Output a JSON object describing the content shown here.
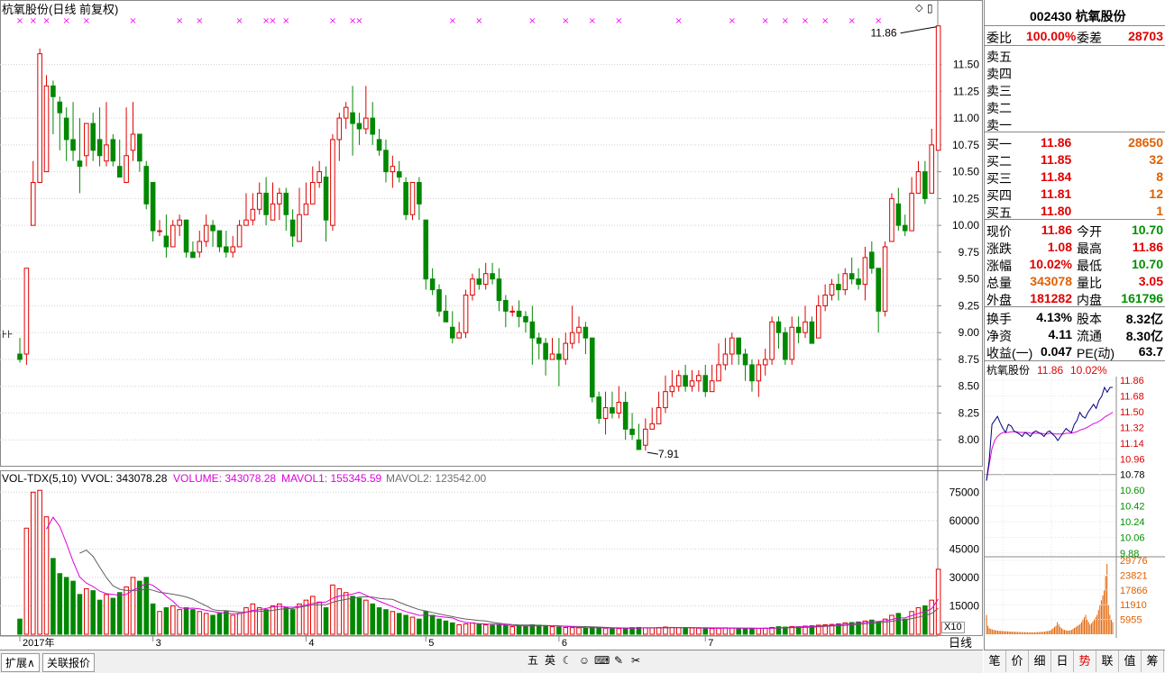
{
  "title": "杭氧股份(日线 前复权)",
  "price_axis": [
    "11.50",
    "11.25",
    "11.00",
    "10.75",
    "10.50",
    "10.25",
    "10.00",
    "9.75",
    "9.50",
    "9.25",
    "9.00",
    "8.75",
    "8.50",
    "8.25",
    "8.00"
  ],
  "vol_axis": [
    "75000",
    "60000",
    "45000",
    "30000",
    "15000"
  ],
  "x10_label": "X10",
  "annotations": {
    "high": "11.86",
    "low": "7.91",
    "left_marker": "⊦⊦"
  },
  "vol_header": {
    "name": "VOL-TDX(5,10)",
    "vvol": "VVOL: 343078.28",
    "volume": "VOLUME: 343078.28",
    "mavol1": "MAVOL1: 155345.59",
    "mavol2": "MAVOL2: 123542.00"
  },
  "date_labels": [
    {
      "label": "2017年",
      "i": 0
    },
    {
      "label": "3",
      "i": 20
    },
    {
      "label": "4",
      "i": 43
    },
    {
      "label": "5",
      "i": 61
    },
    {
      "label": "6",
      "i": 81
    },
    {
      "label": "7",
      "i": 103
    }
  ],
  "period_label": "日线",
  "bottom_tabs": [
    "扩展∧",
    "关联报价"
  ],
  "tool_icons": [
    "五",
    "英",
    "☾",
    "☺",
    "⌨",
    "✎",
    "✂"
  ],
  "colors": {
    "up": "#e00000",
    "down": "#008800",
    "ma1": "#e000e0",
    "ma2": "#606060",
    "marker": "#ff00ff",
    "label": "#ff00ff"
  },
  "side": {
    "header": "002430 杭氧股份",
    "weibi": {
      "label1": "委比",
      "v1": "100.00%",
      "label2": "委差",
      "v2": "28703"
    },
    "sells": [
      {
        "label": "卖五",
        "price": "",
        "vol": ""
      },
      {
        "label": "卖四",
        "price": "",
        "vol": ""
      },
      {
        "label": "卖三",
        "price": "",
        "vol": ""
      },
      {
        "label": "卖二",
        "price": "",
        "vol": ""
      },
      {
        "label": "卖一",
        "price": "",
        "vol": ""
      }
    ],
    "buys": [
      {
        "label": "买一",
        "price": "11.86",
        "vol": "28650"
      },
      {
        "label": "买二",
        "price": "11.85",
        "vol": "32"
      },
      {
        "label": "买三",
        "price": "11.84",
        "vol": "8"
      },
      {
        "label": "买四",
        "price": "11.81",
        "vol": "12"
      },
      {
        "label": "买五",
        "price": "11.80",
        "vol": "1"
      }
    ],
    "quotes": [
      {
        "l1": "现价",
        "v1": "11.86",
        "c1": "red",
        "l2": "今开",
        "v2": "10.70",
        "c2": "grn"
      },
      {
        "l1": "涨跌",
        "v1": "1.08",
        "c1": "red",
        "l2": "最高",
        "v2": "11.86",
        "c2": "red"
      },
      {
        "l1": "涨幅",
        "v1": "10.02%",
        "c1": "red",
        "l2": "最低",
        "v2": "10.70",
        "c2": "grn"
      },
      {
        "l1": "总量",
        "v1": "343078",
        "c1": "org",
        "l2": "量比",
        "v2": "3.05",
        "c2": "red"
      },
      {
        "l1": "外盘",
        "v1": "181282",
        "c1": "red",
        "l2": "内盘",
        "v2": "161796",
        "c2": "grn"
      }
    ],
    "fin": [
      {
        "l1": "换手",
        "v1": "4.13%",
        "l2": "股本",
        "v2": "8.32亿"
      },
      {
        "l1": "净资",
        "v1": "4.11",
        "l2": "流通",
        "v2": "8.30亿"
      },
      {
        "l1": "收益(一)",
        "v1": "0.047",
        "l2": "PE(动)",
        "v2": "63.7"
      }
    ],
    "mini_title": "杭氧股份",
    "mini_price": "11.86",
    "mini_pct": "10.02%",
    "mini_price_axis": [
      {
        "v": "11.86",
        "c": "red"
      },
      {
        "v": "11.68",
        "c": "red"
      },
      {
        "v": "11.50",
        "c": "red"
      },
      {
        "v": "11.32",
        "c": "red"
      },
      {
        "v": "11.14",
        "c": "red"
      },
      {
        "v": "10.96",
        "c": "red"
      },
      {
        "v": "10.78",
        "c": "blk"
      },
      {
        "v": "10.60",
        "c": "grn"
      },
      {
        "v": "10.42",
        "c": "grn"
      },
      {
        "v": "10.24",
        "c": "grn"
      },
      {
        "v": "10.06",
        "c": "grn"
      },
      {
        "v": "9.88",
        "c": "grn"
      }
    ],
    "mini_vol_axis": [
      "29776",
      "23821",
      "17866",
      "11910",
      "5955"
    ],
    "tabs": [
      "笔",
      "价",
      "细",
      "日",
      "势",
      "联",
      "值",
      "筹"
    ]
  },
  "chart_data": {
    "type": "candlestick",
    "title": "杭氧股份(日线 前复权)",
    "ylim": [
      7.75,
      11.95
    ],
    "vol_ylim": [
      0,
      78000
    ],
    "price_ticks": [
      8.0,
      8.25,
      8.5,
      8.75,
      9.0,
      9.25,
      9.5,
      9.75,
      10.0,
      10.25,
      10.5,
      10.75,
      11.0,
      11.25,
      11.5
    ],
    "vol_ticks": [
      15000,
      30000,
      45000,
      60000,
      75000
    ],
    "candles": [
      [
        8.8,
        8.75,
        8.95,
        8.72,
        8000
      ],
      [
        8.8,
        9.6,
        9.6,
        8.7,
        56000
      ],
      [
        10.0,
        10.4,
        10.6,
        10.0,
        75000
      ],
      [
        10.4,
        11.6,
        11.65,
        10.4,
        76000
      ],
      [
        10.5,
        11.3,
        11.4,
        10.5,
        62000
      ],
      [
        11.3,
        11.2,
        11.35,
        10.85,
        40000
      ],
      [
        11.15,
        11.05,
        11.2,
        10.7,
        32000
      ],
      [
        11.0,
        10.8,
        11.1,
        10.6,
        30000
      ],
      [
        10.8,
        10.7,
        11.15,
        10.6,
        28000
      ],
      [
        10.6,
        10.55,
        11.0,
        10.3,
        21000
      ],
      [
        10.65,
        10.95,
        10.95,
        10.55,
        24000
      ],
      [
        10.95,
        10.7,
        11.05,
        10.6,
        23000
      ],
      [
        10.8,
        10.65,
        11.1,
        10.55,
        18000
      ],
      [
        10.6,
        10.75,
        11.15,
        10.55,
        21000
      ],
      [
        10.8,
        10.6,
        10.85,
        10.55,
        19000
      ],
      [
        10.55,
        10.45,
        10.8,
        10.45,
        22000
      ],
      [
        10.4,
        10.65,
        11.1,
        10.4,
        25000
      ],
      [
        10.7,
        10.85,
        11.15,
        10.6,
        30000
      ],
      [
        10.85,
        10.6,
        10.85,
        10.5,
        28000
      ],
      [
        10.55,
        10.2,
        10.6,
        10.15,
        30000
      ],
      [
        10.4,
        9.95,
        10.4,
        9.85,
        16000
      ],
      [
        9.95,
        9.95,
        10.05,
        9.9,
        12000
      ],
      [
        9.9,
        9.8,
        10.1,
        9.7,
        14000
      ],
      [
        9.8,
        10.0,
        10.05,
        9.8,
        15000
      ],
      [
        10.0,
        10.05,
        10.1,
        9.9,
        13000
      ],
      [
        10.05,
        9.75,
        10.05,
        9.7,
        14000
      ],
      [
        9.75,
        9.7,
        9.85,
        9.7,
        13000
      ],
      [
        9.75,
        9.85,
        9.95,
        9.7,
        12000
      ],
      [
        9.85,
        10.0,
        10.1,
        9.8,
        11000
      ],
      [
        10.0,
        9.95,
        10.05,
        9.8,
        10000
      ],
      [
        9.95,
        9.8,
        9.95,
        9.75,
        11000
      ],
      [
        9.8,
        9.75,
        9.95,
        9.7,
        12000
      ],
      [
        9.75,
        9.8,
        9.9,
        9.7,
        10000
      ],
      [
        9.8,
        10.0,
        10.05,
        9.8,
        11000
      ],
      [
        10.0,
        10.05,
        10.3,
        10.0,
        14000
      ],
      [
        10.05,
        10.15,
        10.3,
        10.0,
        16000
      ],
      [
        10.15,
        10.3,
        10.4,
        10.1,
        14000
      ],
      [
        10.3,
        10.1,
        10.45,
        10.0,
        13000
      ],
      [
        10.05,
        10.2,
        10.4,
        10.05,
        15000
      ],
      [
        10.2,
        10.3,
        10.35,
        10.05,
        16000
      ],
      [
        10.3,
        10.1,
        10.35,
        9.95,
        14000
      ],
      [
        10.05,
        9.9,
        10.15,
        9.8,
        13000
      ],
      [
        9.85,
        10.1,
        10.35,
        9.85,
        16000
      ],
      [
        10.1,
        10.2,
        10.4,
        10.1,
        18000
      ],
      [
        10.2,
        10.4,
        10.55,
        10.2,
        20000
      ],
      [
        10.4,
        10.5,
        10.6,
        10.35,
        17000
      ],
      [
        10.45,
        10.05,
        10.55,
        9.85,
        14000
      ],
      [
        10.0,
        10.8,
        10.85,
        9.95,
        26000
      ],
      [
        10.8,
        11.0,
        11.05,
        10.6,
        24000
      ],
      [
        11.0,
        11.1,
        11.15,
        10.9,
        22000
      ],
      [
        11.05,
        10.95,
        11.3,
        10.65,
        20000
      ],
      [
        10.95,
        10.9,
        11.05,
        10.75,
        19000
      ],
      [
        10.9,
        11.0,
        11.3,
        10.85,
        18000
      ],
      [
        11.0,
        10.85,
        11.15,
        10.75,
        16000
      ],
      [
        10.8,
        10.7,
        10.9,
        10.65,
        14000
      ],
      [
        10.7,
        10.5,
        10.8,
        10.4,
        13000
      ],
      [
        10.5,
        10.55,
        10.65,
        10.35,
        12000
      ],
      [
        10.5,
        10.45,
        10.6,
        10.4,
        11000
      ],
      [
        10.4,
        10.1,
        10.45,
        10.05,
        10000
      ],
      [
        10.1,
        10.4,
        10.4,
        10.05,
        9000
      ],
      [
        10.4,
        10.2,
        10.45,
        10.05,
        8000
      ],
      [
        10.05,
        9.5,
        10.05,
        9.4,
        12000
      ],
      [
        9.5,
        9.4,
        9.6,
        9.35,
        10000
      ],
      [
        9.4,
        9.2,
        9.45,
        9.15,
        8000
      ],
      [
        9.2,
        9.1,
        9.35,
        9.1,
        7000
      ],
      [
        9.05,
        8.95,
        9.2,
        8.9,
        6000
      ],
      [
        8.95,
        9.0,
        9.1,
        8.95,
        5000
      ],
      [
        9.0,
        9.35,
        9.4,
        8.95,
        5500
      ],
      [
        9.35,
        9.5,
        9.55,
        9.3,
        6000
      ],
      [
        9.5,
        9.45,
        9.6,
        9.4,
        5500
      ],
      [
        9.45,
        9.55,
        9.65,
        9.4,
        5000
      ],
      [
        9.55,
        9.5,
        9.65,
        9.45,
        4800
      ],
      [
        9.5,
        9.3,
        9.6,
        9.2,
        5000
      ],
      [
        9.3,
        9.2,
        9.35,
        9.05,
        4500
      ],
      [
        9.2,
        9.2,
        9.25,
        9.15,
        4000
      ],
      [
        9.2,
        9.15,
        9.3,
        9.05,
        4200
      ],
      [
        9.15,
        9.1,
        9.2,
        9.0,
        4300
      ],
      [
        9.1,
        8.95,
        9.25,
        8.7,
        5000
      ],
      [
        8.95,
        8.9,
        9.0,
        8.75,
        4800
      ],
      [
        8.9,
        8.75,
        8.95,
        8.6,
        4500
      ],
      [
        8.75,
        8.8,
        8.95,
        8.75,
        4000
      ],
      [
        8.8,
        8.75,
        8.95,
        8.5,
        3800
      ],
      [
        8.75,
        8.9,
        9.0,
        8.7,
        3600
      ],
      [
        8.9,
        9.0,
        9.25,
        8.85,
        3500
      ],
      [
        9.0,
        9.05,
        9.15,
        8.9,
        3400
      ],
      [
        9.05,
        8.95,
        9.1,
        8.8,
        3300
      ],
      [
        8.95,
        8.4,
        8.95,
        8.35,
        3600
      ],
      [
        8.4,
        8.2,
        8.45,
        8.15,
        3400
      ],
      [
        8.2,
        8.3,
        8.45,
        8.05,
        3200
      ],
      [
        8.3,
        8.25,
        8.45,
        8.2,
        3100
      ],
      [
        8.25,
        8.35,
        8.5,
        8.2,
        3000
      ],
      [
        8.35,
        8.1,
        8.45,
        8.0,
        3300
      ],
      [
        8.1,
        8.05,
        8.25,
        8.0,
        3500
      ],
      [
        8.0,
        7.91,
        8.15,
        7.91,
        3600
      ],
      [
        7.95,
        8.1,
        8.2,
        7.9,
        3400
      ],
      [
        8.1,
        8.15,
        8.3,
        8.1,
        3300
      ],
      [
        8.15,
        8.3,
        8.45,
        8.15,
        3500
      ],
      [
        8.3,
        8.45,
        8.6,
        8.25,
        3800
      ],
      [
        8.45,
        8.5,
        8.65,
        8.4,
        3600
      ],
      [
        8.5,
        8.6,
        8.65,
        8.45,
        3500
      ],
      [
        8.6,
        8.5,
        8.7,
        8.45,
        3400
      ],
      [
        8.5,
        8.55,
        8.65,
        8.45,
        3300
      ],
      [
        8.55,
        8.6,
        8.65,
        8.45,
        3200
      ],
      [
        8.6,
        8.45,
        8.7,
        8.4,
        3100
      ],
      [
        8.45,
        8.55,
        8.7,
        8.45,
        3000
      ],
      [
        8.55,
        8.7,
        8.9,
        8.55,
        3200
      ],
      [
        8.7,
        8.8,
        8.95,
        8.65,
        3400
      ],
      [
        8.8,
        8.95,
        9.0,
        8.7,
        3300
      ],
      [
        8.95,
        8.8,
        8.95,
        8.7,
        3200
      ],
      [
        8.8,
        8.7,
        8.85,
        8.55,
        3100
      ],
      [
        8.7,
        8.55,
        8.75,
        8.45,
        3000
      ],
      [
        8.55,
        8.7,
        8.75,
        8.4,
        3100
      ],
      [
        8.7,
        8.75,
        8.85,
        8.6,
        3200
      ],
      [
        8.75,
        9.1,
        9.15,
        8.7,
        3600
      ],
      [
        9.1,
        9.0,
        9.15,
        8.85,
        4000
      ],
      [
        9.0,
        8.75,
        9.05,
        8.7,
        3800
      ],
      [
        8.75,
        9.05,
        9.15,
        8.7,
        4100
      ],
      [
        9.05,
        9.0,
        9.15,
        8.9,
        4000
      ],
      [
        9.0,
        9.1,
        9.25,
        8.95,
        4300
      ],
      [
        9.1,
        8.9,
        9.15,
        8.9,
        4500
      ],
      [
        8.95,
        9.25,
        9.35,
        8.95,
        4800
      ],
      [
        9.25,
        9.35,
        9.45,
        9.2,
        5000
      ],
      [
        9.35,
        9.45,
        9.5,
        9.3,
        5200
      ],
      [
        9.45,
        9.4,
        9.55,
        9.3,
        5500
      ],
      [
        9.4,
        9.55,
        9.6,
        9.35,
        6000
      ],
      [
        9.55,
        9.5,
        9.7,
        9.45,
        6200
      ],
      [
        9.5,
        9.45,
        9.6,
        9.4,
        6500
      ],
      [
        9.45,
        9.7,
        9.8,
        9.3,
        7000
      ],
      [
        9.75,
        9.6,
        9.85,
        9.55,
        7500
      ],
      [
        9.6,
        9.2,
        9.6,
        9.0,
        6500
      ],
      [
        9.2,
        9.8,
        9.85,
        9.15,
        8000
      ],
      [
        9.85,
        10.25,
        10.3,
        9.85,
        10000
      ],
      [
        10.2,
        10.0,
        10.35,
        9.95,
        11000
      ],
      [
        10.0,
        9.95,
        10.1,
        9.9,
        8000
      ],
      [
        9.95,
        10.3,
        10.45,
        9.95,
        12000
      ],
      [
        10.3,
        10.5,
        10.6,
        10.3,
        14000
      ],
      [
        10.5,
        10.25,
        10.6,
        10.2,
        15000
      ],
      [
        10.3,
        10.75,
        10.9,
        10.3,
        18000
      ],
      [
        10.7,
        11.86,
        11.86,
        10.7,
        34300
      ]
    ],
    "ma_period_1": 5,
    "ma_period_2": 10,
    "markers_i": [
      0,
      2,
      4,
      7,
      10,
      17,
      24,
      27,
      33,
      37,
      38,
      40,
      47,
      50,
      51,
      65,
      69,
      77,
      82,
      86,
      90,
      99,
      107,
      112,
      115,
      118,
      121,
      125,
      129
    ],
    "intraday_price": [
      10.7,
      10.95,
      11.4,
      11.45,
      11.5,
      11.42,
      11.35,
      11.3,
      11.4,
      11.38,
      11.32,
      11.3,
      11.28,
      11.25,
      11.3,
      11.28,
      11.25,
      11.3,
      11.32,
      11.3,
      11.28,
      11.25,
      11.3,
      11.32,
      11.28,
      11.25,
      11.2,
      11.25,
      11.3,
      11.35,
      11.32,
      11.3,
      11.4,
      11.45,
      11.55,
      11.5,
      11.48,
      11.55,
      11.6,
      11.65,
      11.6,
      11.7,
      11.75,
      11.86,
      11.8,
      11.86,
      11.86
    ],
    "intraday_avg": [
      10.7,
      10.9,
      11.1,
      11.2,
      11.25,
      11.28,
      11.3,
      11.3,
      11.3,
      11.31,
      11.31,
      11.31,
      11.3,
      11.3,
      11.3,
      11.3,
      11.29,
      11.29,
      11.29,
      11.29,
      11.29,
      11.28,
      11.28,
      11.29,
      11.29,
      11.28,
      11.28,
      11.28,
      11.28,
      11.29,
      11.29,
      11.29,
      11.3,
      11.31,
      11.33,
      11.34,
      11.35,
      11.37,
      11.39,
      11.41,
      11.42,
      11.44,
      11.46,
      11.49,
      11.51,
      11.53,
      11.55
    ],
    "intraday_ylim": [
      9.8,
      11.95
    ],
    "intraday_vol_ylim": [
      0,
      30500
    ],
    "intraday_vol": [
      8000,
      3500,
      2500,
      2200,
      2000,
      1800,
      1700,
      1600,
      1500,
      1400,
      1400,
      1300,
      1300,
      1200,
      1200,
      1200,
      1100,
      1100,
      1100,
      1000,
      1000,
      1000,
      950,
      900,
      900,
      900,
      850,
      850,
      850,
      800,
      800,
      800,
      800,
      800,
      800,
      850,
      900,
      900,
      950,
      1000,
      1000,
      1100,
      1200,
      1300,
      1400,
      1600,
      2000,
      2500,
      3000,
      3500,
      5000,
      4000,
      3000,
      2500,
      2000,
      1800,
      1600,
      1500,
      1500,
      1600,
      1800,
      2200,
      2600,
      3000,
      3400,
      3800,
      4200,
      5000,
      6000,
      7000,
      8000,
      6000,
      5000,
      4000,
      4500,
      5200,
      6000,
      7000,
      8000,
      10000,
      12000,
      14000,
      16000,
      18000,
      24000,
      29000,
      12000,
      8000,
      6000,
      5000
    ]
  }
}
